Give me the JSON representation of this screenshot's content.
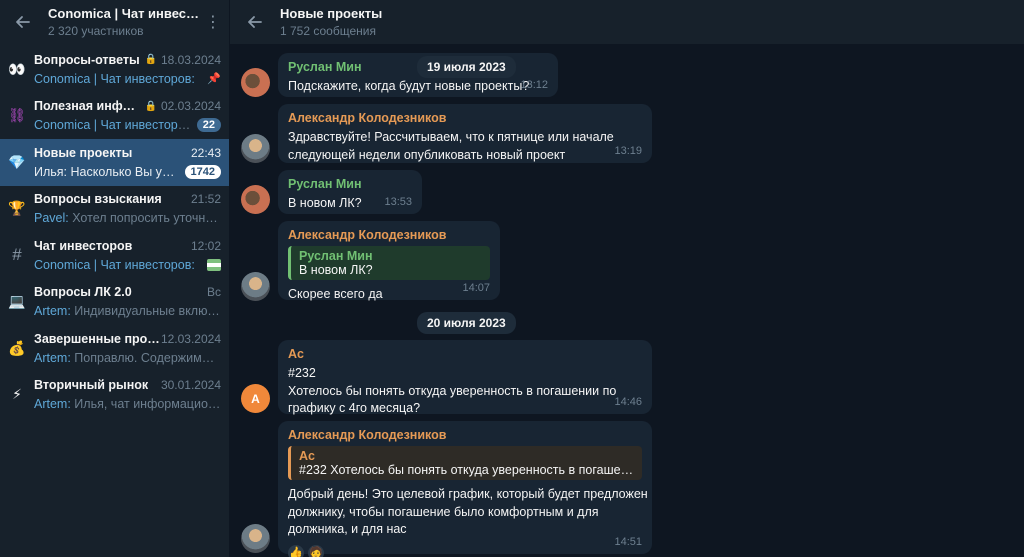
{
  "sidebar": {
    "title": "Conomica | Чат инвесто...",
    "subtitle": "2 320 участников",
    "chats": [
      {
        "icon": "👀",
        "name": "Вопросы-ответы",
        "muted": true,
        "date": "18.03.2024",
        "who": "Conomica | Чат инвесторов:",
        "last": "",
        "pinned": true
      },
      {
        "icon": "⛓",
        "name": "Полезная инфор...",
        "muted": true,
        "date": "02.03.2024",
        "who": "Conomica | Чат инвесторов:",
        "last": "",
        "badge": "22"
      },
      {
        "icon": "💎",
        "name": "Новые проекты",
        "date": "22:43",
        "who": "Илья:",
        "last": "Насколько Вы увер...",
        "badge": "1742",
        "active": true
      },
      {
        "icon": "🏆",
        "name": "Вопросы взыскания",
        "date": "21:52",
        "who": "Pavel:",
        "last": "Хотел попросить уточнить..."
      },
      {
        "icon": "#",
        "name": "Чат инвесторов",
        "date": "12:02",
        "who": "Conomica | Чат инвесторов:",
        "last": "",
        "flag": true
      },
      {
        "icon": "💻",
        "name": "Вопросы ЛК 2.0",
        "date": "Вс",
        "who": "Artem:",
        "last": "Индивидуальные включе..."
      },
      {
        "icon": "💰",
        "name": "Завершенные проек...",
        "date": "12.03.2024",
        "who": "Artem:",
        "last": "Поправлю. Содержимое ..."
      },
      {
        "icon": "⚡",
        "name": "Вторичный рынок",
        "date": "30.01.2024",
        "who": "Artem:",
        "last": "Илья, чат информационн..."
      }
    ]
  },
  "header": {
    "title": "Новые проекты",
    "subtitle": "1 752 сообщения"
  },
  "dates": [
    "19 июля 2023",
    "20 июля 2023"
  ],
  "messages": [
    {
      "sender": "Руслан Мин",
      "text": "Подскажите, когда будут новые проекты?",
      "time": "13:12"
    },
    {
      "sender": "Александр Колодезников",
      "text": "Здравствуйте! Рассчитываем, что к пятнице или начале следующей недели опубликовать новый проект",
      "time": "13:19"
    },
    {
      "sender": "Руслан Мин",
      "text": "В новом ЛК?",
      "time": "13:53"
    },
    {
      "sender": "Александр Колодезников",
      "reply_name": "Руслан Мин",
      "reply_text": "В новом ЛК?",
      "text": "Скорее всего да",
      "time": "14:07"
    },
    {
      "sender": "Ac",
      "avatar": "A",
      "text": "#232\nХотелось бы понять откуда уверенность в погашении по графику с 4го месяца?",
      "time": "14:46"
    },
    {
      "sender": "Александр Колодезников",
      "reply_name": "Ac",
      "reply_text": "#232 Хотелось бы понять откуда уверенность в погашении п...",
      "text": "Добрый день! Это целевой график, который будет предложен должнику, чтобы погашение было комфортным и для должника, и для нас",
      "time": "14:51",
      "reactions": [
        "👍",
        "🧑"
      ]
    }
  ]
}
